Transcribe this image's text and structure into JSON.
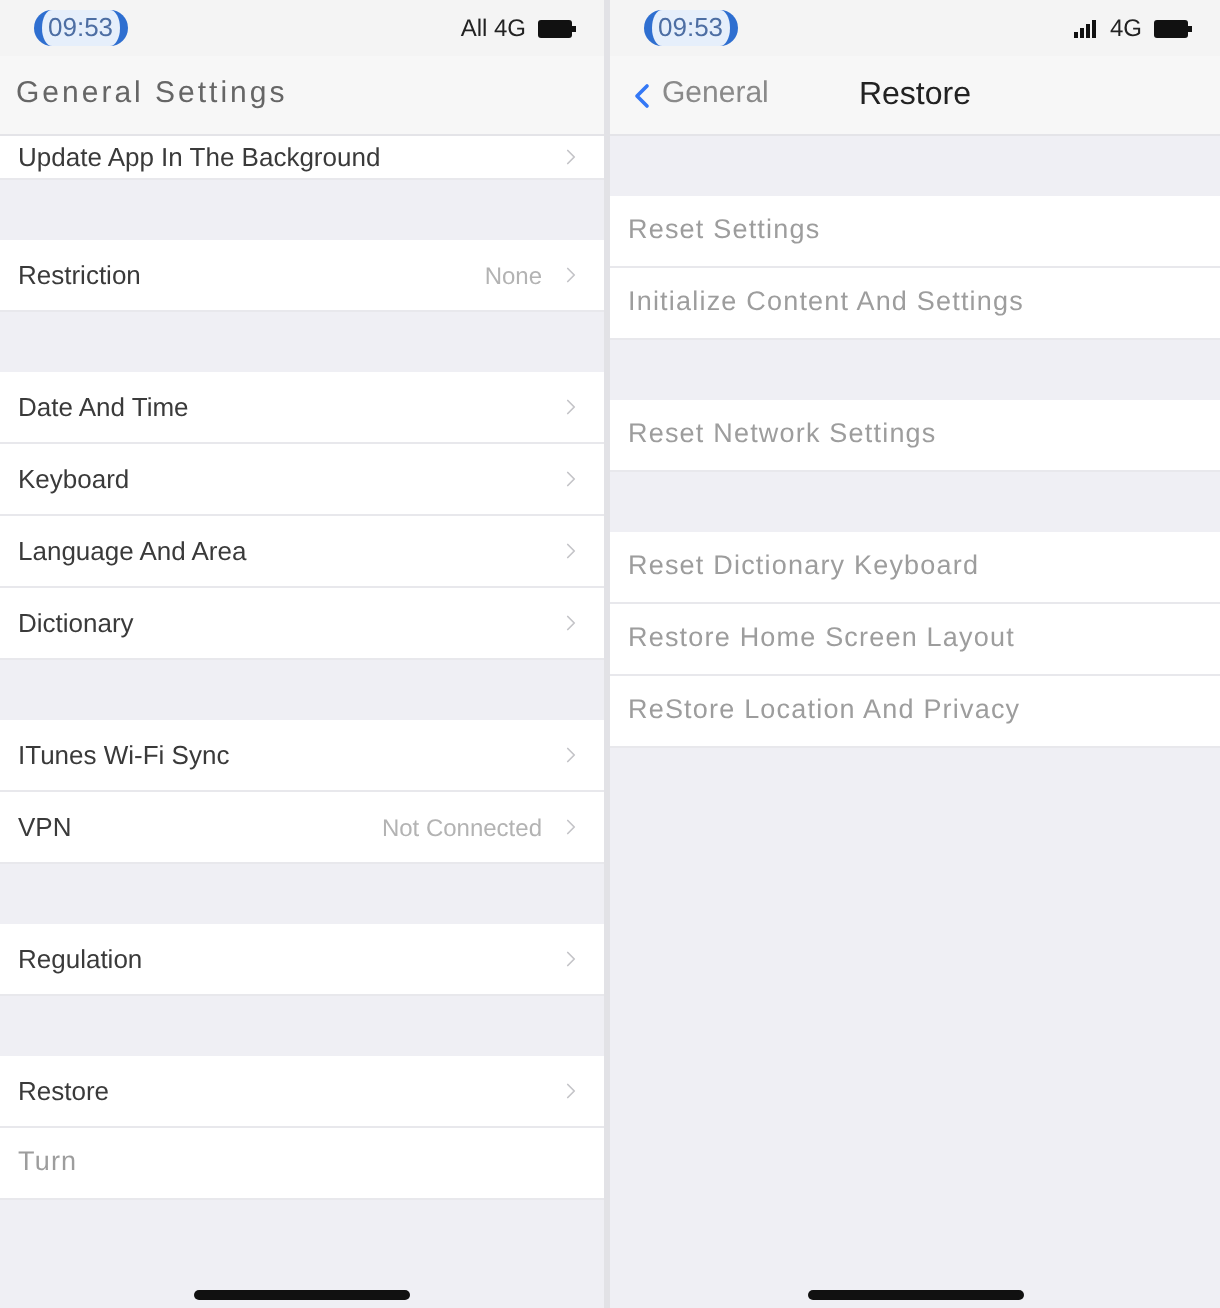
{
  "screens": [
    {
      "scrolled": true,
      "status_bar": {
        "time": "09:53",
        "network": "All 4G",
        "signal_icon": false
      },
      "nav": {
        "title": "General Settings"
      },
      "groups": [
        [
          {
            "label": "Update App In The Background",
            "kind": "link"
          }
        ],
        [
          {
            "label": "Restriction",
            "value": "None",
            "kind": "link"
          }
        ],
        [
          {
            "label": "Date And Time",
            "kind": "link"
          },
          {
            "label": "Keyboard",
            "kind": "link"
          },
          {
            "label": "Language And Area",
            "kind": "link"
          },
          {
            "label": "Dictionary",
            "kind": "link"
          }
        ],
        [
          {
            "label": "ITunes Wi-Fi Sync",
            "kind": "link"
          },
          {
            "label": "VPN",
            "value": "Not Connected",
            "kind": "link"
          }
        ],
        [
          {
            "label": "Regulation",
            "kind": "link"
          }
        ],
        [
          {
            "label": "Restore",
            "kind": "link"
          },
          {
            "label": "Turn",
            "kind": "action"
          }
        ]
      ]
    },
    {
      "scrolled": false,
      "status_bar": {
        "time": "09:53",
        "network": "4G",
        "signal_icon": true
      },
      "nav": {
        "back": "General",
        "title": "Restore"
      },
      "groups": [
        [
          {
            "label": "Reset Settings",
            "kind": "action"
          },
          {
            "label": "Initialize Content And Settings",
            "kind": "action"
          }
        ],
        [
          {
            "label": "Reset Network Settings",
            "kind": "action"
          }
        ],
        [
          {
            "label": "Reset Dictionary Keyboard",
            "kind": "action"
          },
          {
            "label": "Restore Home Screen Layout",
            "kind": "action"
          },
          {
            "label": "ReStore Location And Privacy",
            "kind": "action"
          }
        ]
      ]
    }
  ]
}
